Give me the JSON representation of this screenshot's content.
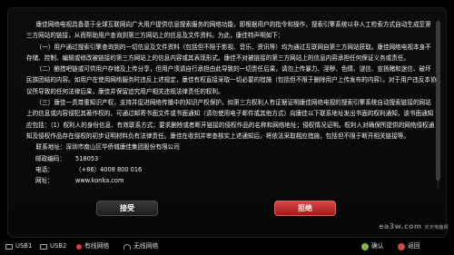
{
  "agreement": {
    "paragraphs": [
      "康佳网络电视具备基于全球互联网向广大用户提供信息搜索服务的网络功能，即根据用户的指令和操作，搜索引擎系统以非人工检索方式自动生成至第三方网站的链接，从而帮助用户查询到第三方网站上的信息及文件资料。为此，康佳特声明如下：",
      "（一）用户通过搜索引擎查询到的一切信息及文件资料（包括但不限于影视、音乐、资讯等）均为通过互联网自第三方网站获取。康佳网络电视本身不存储、控制、编辑或修改被链接的第三方网站上的信息内容或其表现形式。康佳不对被链接的第三方网站上的信息内容承担任何保证义务或责任。",
      "（二）酿措吧链或可供用户存储及上传分享，但用户须请自行承担由此导致的一切责任后果，请勿上传暴力、淫秽、色情、谜信、宣扬赌和迷信、破坏民族团结的内容。如用户在使用网络服务时违反上述规定，康佳有权直接采取一切必要的措施（包括但不限于删除用户上传发布的内容）。对于用户违反本协议所导致的任何法律后果，康佳并保留追究用户相关违规法律责任的权利。",
      "（三）康佳一贯尊重知识产权，支持并促进网络传播中的知识产权保护。如第三方权利人有证据证明康佳网络电视的搜索引擎系统自动搜索链接的网站上的信息或内容侵犯其著作权的，可通过邮寄书面文件或书面通知（请勿使用电子邮件或其他方式）向康佳以下联系地址发出书面的权利通知，该书面通知应包括：（1）权利人的身份信息、有效联系方式；要求删除或者断开链接的侵权作品的名称和网络地址；侵权情况证明。权利人对确保所提供的网络侵权通知及侵权作品存在侵权的初步证明材料负有法律责任。康佳在收到并审查核实上述通知后，将依法采取相应措施，包括但不限于断开相关链接等。",
      "联系地址：深圳市南山区华侨城康佳集团股份有限公司"
    ],
    "contact": [
      {
        "label": "邮政编码：",
        "value": "518053"
      },
      {
        "label": "电话：",
        "value": "（+86）4008 800 016"
      },
      {
        "label": "网址：",
        "value": "www.konka.com"
      }
    ]
  },
  "buttons": {
    "accept": "接受",
    "reject": "拒绝"
  },
  "statusbar": {
    "usb1": "USB1",
    "usb2": "USB2",
    "wired": "有线网络",
    "wireless": "无线网络",
    "confirm": "确认",
    "back": "返回"
  },
  "watermark": {
    "logo": "ea3w.com",
    "sub": "天天电脑网"
  }
}
